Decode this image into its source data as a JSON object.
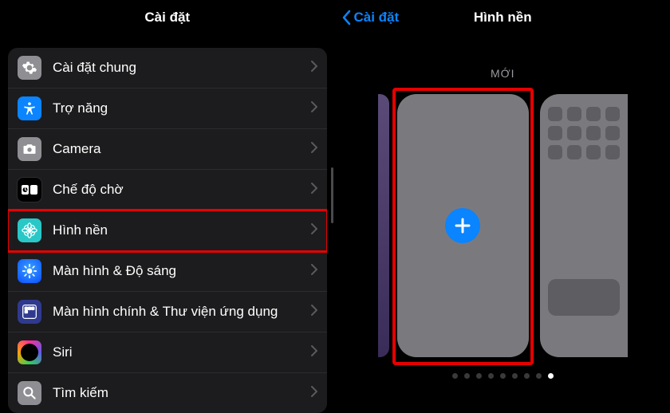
{
  "left": {
    "title": "Cài đặt",
    "rows": [
      {
        "id": "general",
        "label": "Cài đặt chung",
        "icon": "gear-icon",
        "bg": "bg-gray"
      },
      {
        "id": "access",
        "label": "Trợ năng",
        "icon": "accessibility-icon",
        "bg": "bg-blue"
      },
      {
        "id": "camera",
        "label": "Camera",
        "icon": "camera-icon",
        "bg": "bg-gray"
      },
      {
        "id": "standby",
        "label": "Chế độ chờ",
        "icon": "standby-icon",
        "bg": "bg-dark"
      },
      {
        "id": "wallpaper",
        "label": "Hình nền",
        "icon": "flower-icon",
        "bg": "bg-teal",
        "highlight": true
      },
      {
        "id": "display",
        "label": "Màn hình & Độ sáng",
        "icon": "brightness-icon",
        "bg": "bg-bluegrad"
      },
      {
        "id": "homescreen",
        "label": "Màn hình chính & Thư viện ứng dụng",
        "icon": "apps-icon",
        "bg": "bg-indigo"
      },
      {
        "id": "siri",
        "label": "Siri",
        "icon": "siri-icon",
        "bg": "bg-siri"
      },
      {
        "id": "search",
        "label": "Tìm kiếm",
        "icon": "search-icon",
        "bg": "bg-gray"
      }
    ]
  },
  "right": {
    "back": "Cài đặt",
    "title": "Hình nền",
    "newLabel": "MỚI",
    "pageDots": {
      "count": 9,
      "active": 8
    }
  }
}
